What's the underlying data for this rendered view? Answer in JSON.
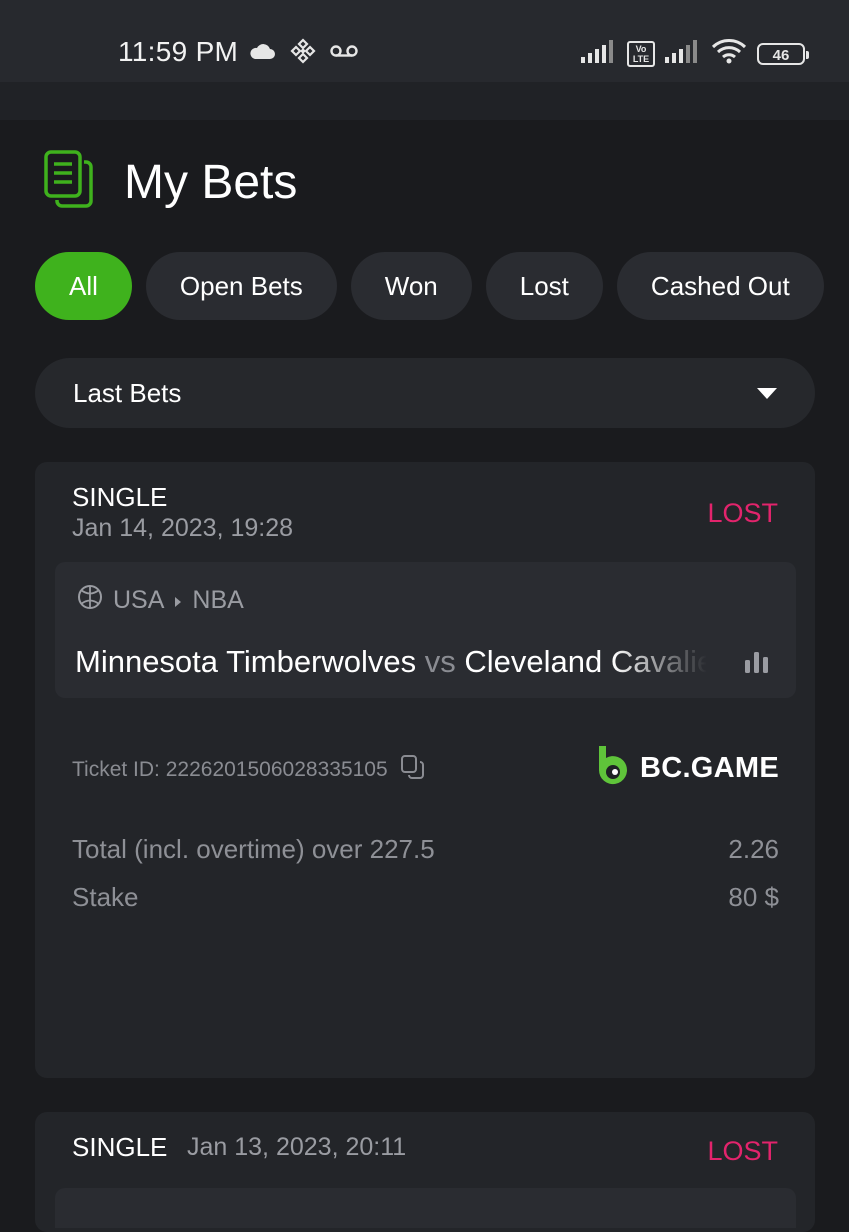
{
  "status_bar": {
    "time": "11:59 PM",
    "icons_left": [
      "cloud-icon",
      "binance-icon",
      "voicemail-icon"
    ],
    "icons_right": [
      "signal-icon",
      "volte-icon",
      "signal-icon",
      "wifi-icon",
      "battery-icon"
    ],
    "volte_label": "Vo LTE",
    "battery": "46"
  },
  "header": {
    "title": "My Bets",
    "icon": "documents-icon"
  },
  "tabs": [
    {
      "label": "All",
      "active": true
    },
    {
      "label": "Open Bets",
      "active": false
    },
    {
      "label": "Won",
      "active": false
    },
    {
      "label": "Lost",
      "active": false
    },
    {
      "label": "Cashed Out",
      "active": false
    }
  ],
  "filter": {
    "selected": "Last Bets",
    "icon": "caret-down-icon"
  },
  "colors": {
    "accent": "#3fb21d",
    "lost": "#e2246c",
    "background": "#1a1b1e",
    "card": "#232529"
  },
  "bets": [
    {
      "type": "SINGLE",
      "date": "Jan 14, 2023, 19:28",
      "status": "LOST",
      "country": "USA",
      "league": "NBA",
      "team_home": "Minnesota Timberwolves",
      "vs": "vs",
      "team_away": "Cleveland Cavaliers",
      "ticket_label": "Ticket ID:",
      "ticket_id": "2226201506028335105",
      "brand": "BC.GAME",
      "selection": "Total (incl. overtime) over 227.5",
      "odds": "2.26",
      "stake_label": "Stake",
      "stake": "80 $"
    },
    {
      "type": "SINGLE",
      "date": "Jan 13, 2023, 20:11",
      "status": "LOST"
    }
  ]
}
